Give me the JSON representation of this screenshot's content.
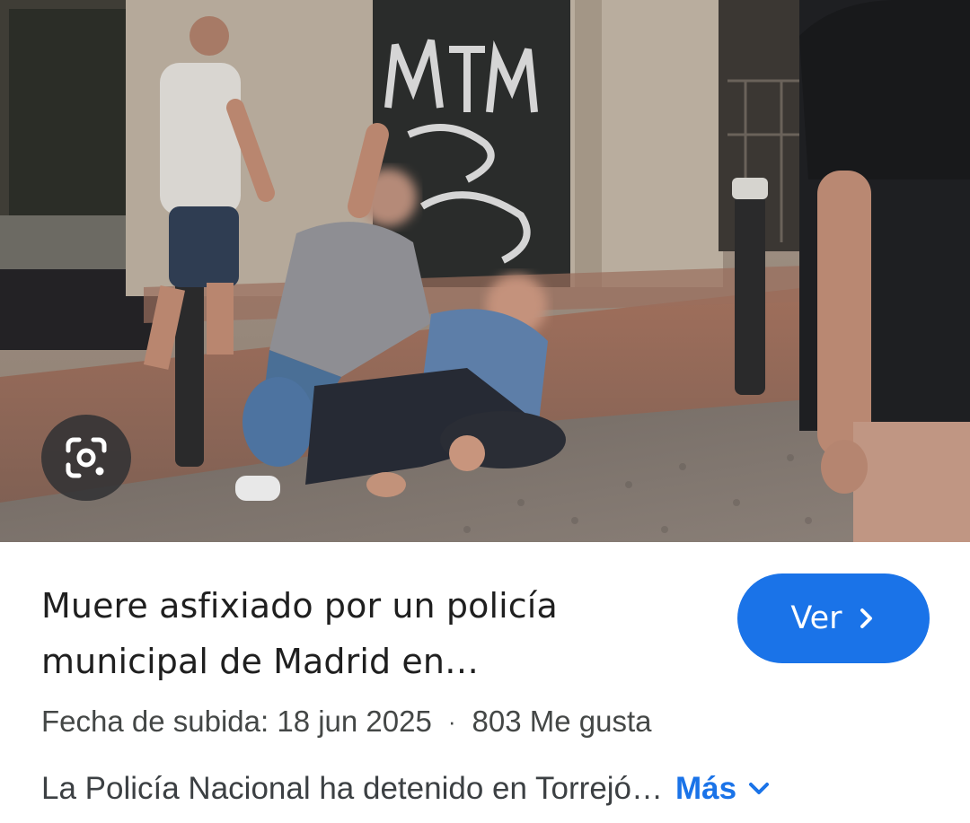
{
  "image": {
    "alt": "",
    "lens_icon": "google-lens-icon"
  },
  "result": {
    "title_line1": "Muere asfixiado por un policía",
    "title_line2": "municipal de Madrid en…",
    "view_button_label": "Ver",
    "view_button_icon": "chevron-right-icon",
    "upload_date": "Fecha de subida: 18 jun 2025",
    "separator": "·",
    "likes": "803 Me gusta",
    "description": "La Policía Nacional ha detenido en Torrejó…",
    "more_label": "Más",
    "more_icon": "chevron-down-icon"
  },
  "colors": {
    "accent": "#1a73e8",
    "title_text": "#1f1f1f",
    "secondary_text": "#444746",
    "lens_bg": "#323234"
  }
}
